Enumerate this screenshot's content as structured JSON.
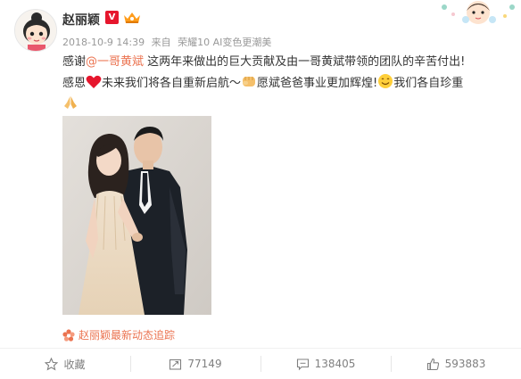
{
  "author": {
    "name": "赵丽颖",
    "verified_mark": "V"
  },
  "meta": {
    "timestamp": "2018-10-9 14:39",
    "via_prefix": "来自",
    "device": "荣耀10 AI变色更潮美"
  },
  "post": {
    "line1_a": "感谢",
    "mention": "@一哥黄斌",
    "line1_b": " 这两年来做出的巨大贡献及由一哥黄斌带领的团队的辛苦付出!",
    "line2_a": "感恩",
    "line2_b": "未来我们将各自重新启航～",
    "line2_c": "愿斌爸爸事业更加辉煌!",
    "line2_d": "我们各自珍重"
  },
  "source_link": "赵丽颖最新动态追踪",
  "actions": {
    "favorite_label": "收藏",
    "repost_count": "77149",
    "comment_count": "138405",
    "like_count": "593883"
  },
  "colors": {
    "mention": "#eb7350",
    "verified": "#e6162d",
    "meta_text": "#999999",
    "action_text": "#808080"
  }
}
